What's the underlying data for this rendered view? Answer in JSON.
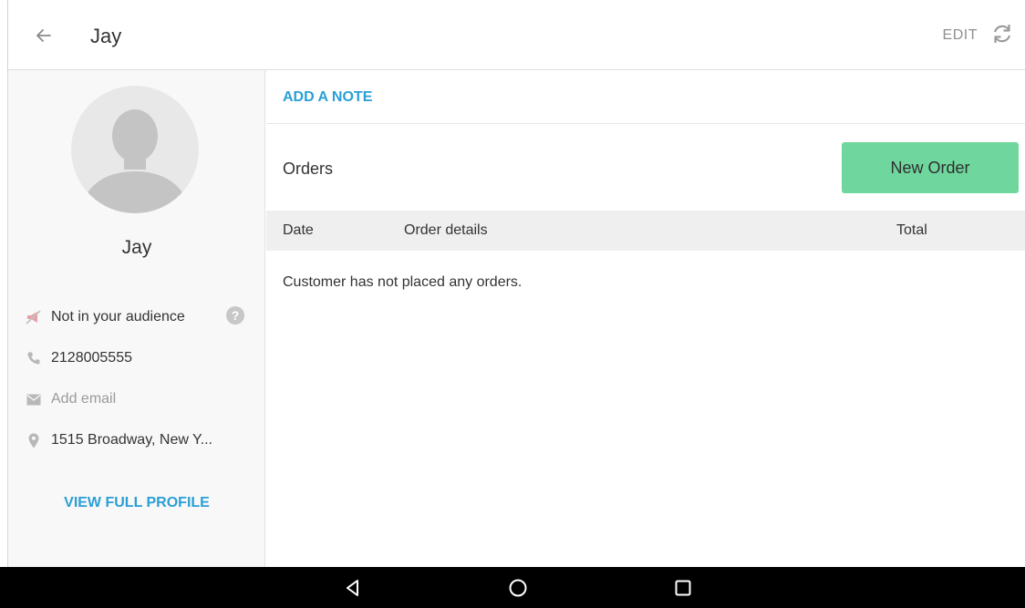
{
  "header": {
    "title": "Jay",
    "edit_label": "EDIT",
    "back_icon": "arrow-left-icon",
    "refresh_icon": "refresh-icon"
  },
  "customer": {
    "name": "Jay",
    "audience_status": "Not in your audience",
    "phone": "2128005555",
    "email_placeholder": "Add email",
    "address": "1515 Broadway, New Y...",
    "view_profile_label": "VIEW FULL PROFILE"
  },
  "main": {
    "add_note_label": "ADD A NOTE",
    "orders_label": "Orders",
    "new_order_label": "New Order",
    "table": {
      "columns": [
        "Date",
        "Order details",
        "Total"
      ]
    },
    "empty_message": "Customer has not placed any orders."
  },
  "colors": {
    "accent_link": "#2a9fd6",
    "new_order_button": "#6fd69d",
    "nav_bar": "#000000"
  }
}
